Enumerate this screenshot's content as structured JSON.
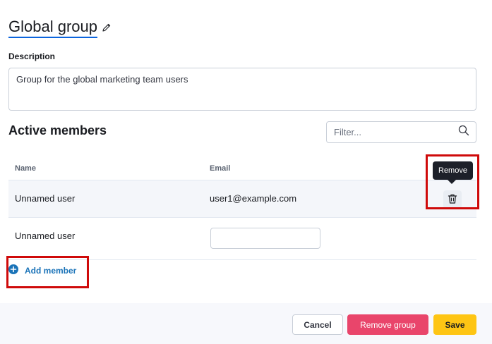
{
  "group": {
    "title": "Global group",
    "description_label": "Description",
    "description": "Group for the global marketing team users"
  },
  "members": {
    "section_title": "Active members",
    "filter_placeholder": "Filter...",
    "columns": {
      "name": "Name",
      "email": "Email"
    },
    "rows": [
      {
        "name": "Unnamed user",
        "email": "user1@example.com"
      },
      {
        "name": "Unnamed user",
        "email": ""
      }
    ],
    "remove_tooltip": "Remove",
    "add_member_label": "Add member"
  },
  "footer": {
    "cancel_label": "Cancel",
    "remove_group_label": "Remove group",
    "save_label": "Save"
  },
  "colors": {
    "accent_blue": "#1a73b8",
    "danger": "#e9456b",
    "save_yellow": "#fec514",
    "highlight_red": "#cf0a0a"
  },
  "icons": [
    "pencil-icon",
    "search-icon",
    "trash-icon",
    "plus-circle-icon"
  ]
}
